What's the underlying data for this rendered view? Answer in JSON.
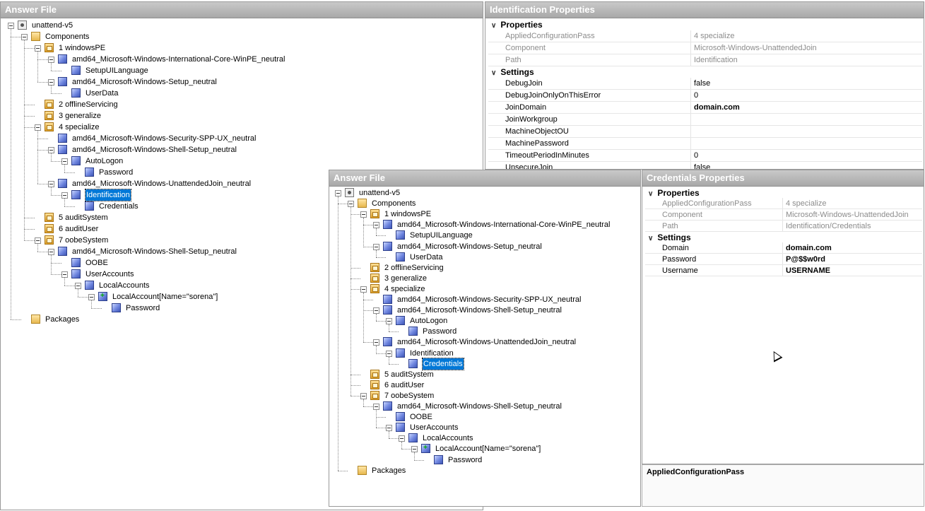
{
  "answer_file_1": {
    "title": "Answer File",
    "tree": [
      {
        "label": "unattend-v5",
        "icon": "root",
        "expanded": true
      },
      {
        "label": "Components",
        "icon": "folder",
        "expanded": true
      },
      {
        "label": "1 windowsPE",
        "icon": "pass",
        "expanded": true
      },
      {
        "label": "amd64_Microsoft-Windows-International-Core-WinPE_neutral",
        "icon": "comp",
        "expanded": true
      },
      {
        "label": "SetupUILanguage",
        "icon": "comp"
      },
      {
        "label": "amd64_Microsoft-Windows-Setup_neutral",
        "icon": "comp",
        "expanded": true
      },
      {
        "label": "UserData",
        "icon": "comp"
      },
      {
        "label": "2 offlineServicing",
        "icon": "pass"
      },
      {
        "label": "3 generalize",
        "icon": "pass"
      },
      {
        "label": "4 specialize",
        "icon": "pass",
        "expanded": true
      },
      {
        "label": "amd64_Microsoft-Windows-Security-SPP-UX_neutral",
        "icon": "comp"
      },
      {
        "label": "amd64_Microsoft-Windows-Shell-Setup_neutral",
        "icon": "comp",
        "expanded": true
      },
      {
        "label": "AutoLogon",
        "icon": "comp",
        "expanded": true
      },
      {
        "label": "Password",
        "icon": "comp"
      },
      {
        "label": "amd64_Microsoft-Windows-UnattendedJoin_neutral",
        "icon": "comp",
        "expanded": true
      },
      {
        "label": "Identification",
        "icon": "comp",
        "expanded": true,
        "selected": true
      },
      {
        "label": "Credentials",
        "icon": "comp"
      },
      {
        "label": "5 auditSystem",
        "icon": "pass"
      },
      {
        "label": "6 auditUser",
        "icon": "pass"
      },
      {
        "label": "7 oobeSystem",
        "icon": "pass",
        "expanded": true
      },
      {
        "label": "amd64_Microsoft-Windows-Shell-Setup_neutral",
        "icon": "comp",
        "expanded": true
      },
      {
        "label": "OOBE",
        "icon": "comp"
      },
      {
        "label": "UserAccounts",
        "icon": "comp",
        "expanded": true
      },
      {
        "label": "LocalAccounts",
        "icon": "comp",
        "expanded": true
      },
      {
        "label": "LocalAccount[Name=\"sorena\"]",
        "icon": "list",
        "expanded": true
      },
      {
        "label": "Password",
        "icon": "comp"
      },
      {
        "label": "Packages",
        "icon": "folder"
      }
    ]
  },
  "identification_properties": {
    "title": "Identification Properties",
    "sections": [
      {
        "name": "Properties",
        "rows": [
          {
            "name": "AppliedConfigurationPass",
            "value": "4 specialize",
            "readonly": true
          },
          {
            "name": "Component",
            "value": "Microsoft-Windows-UnattendedJoin",
            "readonly": true
          },
          {
            "name": "Path",
            "value": "Identification",
            "readonly": true
          }
        ]
      },
      {
        "name": "Settings",
        "rows": [
          {
            "name": "DebugJoin",
            "value": "false"
          },
          {
            "name": "DebugJoinOnlyOnThisError",
            "value": "0"
          },
          {
            "name": "JoinDomain",
            "value": "domain.com",
            "bold": true
          },
          {
            "name": "JoinWorkgroup",
            "value": ""
          },
          {
            "name": "MachineObjectOU",
            "value": ""
          },
          {
            "name": "MachinePassword",
            "value": ""
          },
          {
            "name": "TimeoutPeriodInMinutes",
            "value": "0"
          },
          {
            "name": "UnsecureJoin",
            "value": "false"
          }
        ]
      }
    ]
  },
  "answer_file_2": {
    "title": "Answer File",
    "tree": [
      {
        "label": "unattend-v5",
        "icon": "root",
        "expanded": true
      },
      {
        "label": "Components",
        "icon": "folder",
        "expanded": true
      },
      {
        "label": "1 windowsPE",
        "icon": "pass",
        "expanded": true
      },
      {
        "label": "amd64_Microsoft-Windows-International-Core-WinPE_neutral",
        "icon": "comp",
        "expanded": true
      },
      {
        "label": "SetupUILanguage",
        "icon": "comp"
      },
      {
        "label": "amd64_Microsoft-Windows-Setup_neutral",
        "icon": "comp",
        "expanded": true
      },
      {
        "label": "UserData",
        "icon": "comp"
      },
      {
        "label": "2 offlineServicing",
        "icon": "pass"
      },
      {
        "label": "3 generalize",
        "icon": "pass"
      },
      {
        "label": "4 specialize",
        "icon": "pass",
        "expanded": true
      },
      {
        "label": "amd64_Microsoft-Windows-Security-SPP-UX_neutral",
        "icon": "comp"
      },
      {
        "label": "amd64_Microsoft-Windows-Shell-Setup_neutral",
        "icon": "comp",
        "expanded": true
      },
      {
        "label": "AutoLogon",
        "icon": "comp",
        "expanded": true
      },
      {
        "label": "Password",
        "icon": "comp"
      },
      {
        "label": "amd64_Microsoft-Windows-UnattendedJoin_neutral",
        "icon": "comp",
        "expanded": true
      },
      {
        "label": "Identification",
        "icon": "comp",
        "expanded": true
      },
      {
        "label": "Credentials",
        "icon": "comp",
        "selected": true
      },
      {
        "label": "5 auditSystem",
        "icon": "pass"
      },
      {
        "label": "6 auditUser",
        "icon": "pass"
      },
      {
        "label": "7 oobeSystem",
        "icon": "pass",
        "expanded": true
      },
      {
        "label": "amd64_Microsoft-Windows-Shell-Setup_neutral",
        "icon": "comp",
        "expanded": true
      },
      {
        "label": "OOBE",
        "icon": "comp"
      },
      {
        "label": "UserAccounts",
        "icon": "comp",
        "expanded": true
      },
      {
        "label": "LocalAccounts",
        "icon": "comp",
        "expanded": true
      },
      {
        "label": "LocalAccount[Name=\"sorena\"]",
        "icon": "list",
        "expanded": true
      },
      {
        "label": "Password",
        "icon": "comp"
      },
      {
        "label": "Packages",
        "icon": "folder"
      }
    ]
  },
  "credentials_properties": {
    "title": "Credentials Properties",
    "sections": [
      {
        "name": "Properties",
        "rows": [
          {
            "name": "AppliedConfigurationPass",
            "value": "4 specialize",
            "readonly": true
          },
          {
            "name": "Component",
            "value": "Microsoft-Windows-UnattendedJoin",
            "readonly": true
          },
          {
            "name": "Path",
            "value": "Identification/Credentials",
            "readonly": true
          }
        ]
      },
      {
        "name": "Settings",
        "rows": [
          {
            "name": "Domain",
            "value": "domain.com",
            "bold": true
          },
          {
            "name": "Password",
            "value": "P@$$w0rd",
            "bold": true
          },
          {
            "name": "Username",
            "value": "USERNAME",
            "bold": true
          }
        ]
      }
    ],
    "description_title": "AppliedConfigurationPass"
  }
}
